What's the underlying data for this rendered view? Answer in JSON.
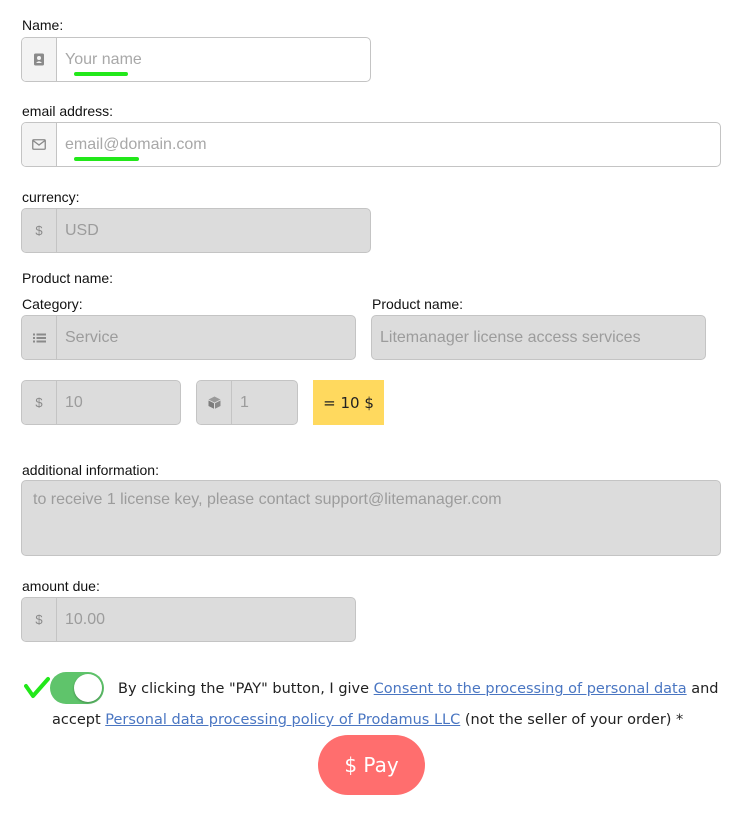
{
  "form": {
    "name_label": "Name:",
    "name_placeholder": "Your name",
    "email_label": "email address:",
    "email_placeholder": "email@domain.com",
    "currency_label": "currency:",
    "currency_symbol": "$",
    "currency_value": "USD",
    "product_section_label": "Product name:",
    "category_label": "Category:",
    "category_value": "Service",
    "product_name_label": "Product name:",
    "product_name_value": "Litemanager license access services",
    "price_symbol": "$",
    "price_value": "10",
    "quantity_value": "1",
    "total_text": "= 10 $",
    "additional_label": "additional information:",
    "additional_value": "to receive 1 license key, please contact support@litemanager.com",
    "amount_label": "amount due:",
    "amount_symbol": "$",
    "amount_value": "10.00"
  },
  "consent": {
    "prefix": "By clicking the \"PAY\" button, I give ",
    "link1": "Consent to the processing of personal data",
    "middle": " and accept ",
    "link2": "Personal data processing policy of Prodamus LLC",
    "suffix": " (not the seller of your order) *",
    "toggle_on": true
  },
  "pay_button": "$ Pay",
  "icons": {
    "name": "contact-card-icon",
    "email": "envelope-icon",
    "category": "list-icon",
    "quantity": "box-icon"
  },
  "colors": {
    "annotation_green": "#22e81a",
    "toggle_on": "#5fc46b",
    "total_bg": "#ffd95e",
    "pay_bg": "#ff6e6e",
    "link": "#4a76c2"
  }
}
